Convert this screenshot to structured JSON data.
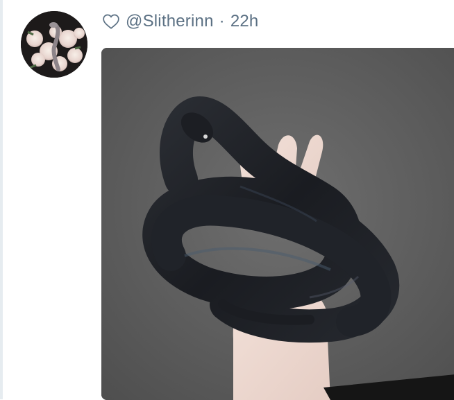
{
  "post": {
    "handle": "@Slitherinn",
    "separator": "·",
    "time_ago": "22h"
  },
  "icons": {
    "like": "heart-outline-icon"
  },
  "colors": {
    "meta_text": "#5b7083",
    "rail": "#e6ecf0"
  }
}
